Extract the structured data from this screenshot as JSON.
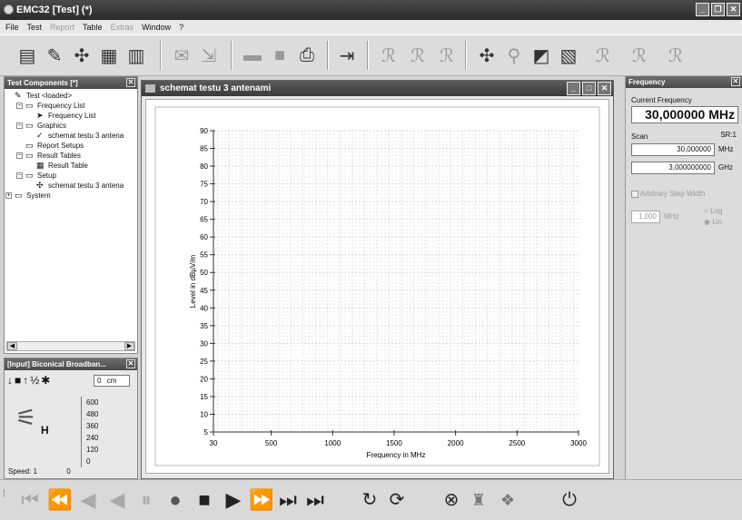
{
  "window": {
    "title": "EMC32 [Test] (*)",
    "buttons": [
      "_",
      "❐",
      "✕"
    ]
  },
  "menu": [
    {
      "label": "File",
      "enabled": true
    },
    {
      "label": "Test",
      "enabled": true
    },
    {
      "label": "Report",
      "enabled": false
    },
    {
      "label": "Table",
      "enabled": true
    },
    {
      "label": "Extras",
      "enabled": false
    },
    {
      "label": "Window",
      "enabled": true
    },
    {
      "label": "?",
      "enabled": true
    }
  ],
  "toolbar_icons": [
    "report-editor-icon",
    "graphics-edit-icon",
    "test-setup-icon",
    "device-list-icon",
    "result-table-icon",
    "print-preview-icon",
    "export-icon",
    "open-folder-icon",
    "save-icon",
    "print-icon",
    "exit-icon",
    "new-test-icon",
    "run-test-icon",
    "test-template-icon",
    "setup-active-icon",
    "transducer-icon",
    "graphics-icon",
    "report-icon",
    "emi-test-icon",
    "emi-test-1-icon",
    "emi-test-2-icon"
  ],
  "test_components": {
    "title": "Test Components [*]",
    "tree": [
      {
        "level": 0,
        "label": "Test <loaded>",
        "toggle": "",
        "icon": "test-icon"
      },
      {
        "level": 1,
        "label": "Frequency List",
        "toggle": "−",
        "icon": "folder-icon"
      },
      {
        "level": 2,
        "label": "Frequency List",
        "toggle": "",
        "icon": "frequency-list-icon"
      },
      {
        "level": 1,
        "label": "Graphics",
        "toggle": "−",
        "icon": "folder-icon"
      },
      {
        "level": 2,
        "label": "schemat testu 3 antena",
        "toggle": "",
        "icon": "graphics-icon"
      },
      {
        "level": 1,
        "label": "Report Setups",
        "toggle": "",
        "icon": "folder-icon"
      },
      {
        "level": 1,
        "label": "Result Tables",
        "toggle": "−",
        "icon": "folder-icon"
      },
      {
        "level": 2,
        "label": "Result Table",
        "toggle": "",
        "icon": "table-icon"
      },
      {
        "level": 1,
        "label": "Setup",
        "toggle": "−",
        "icon": "folder-icon"
      },
      {
        "level": 2,
        "label": "schemat testu 3 antena",
        "toggle": "",
        "icon": "setup-icon"
      },
      {
        "level": 0,
        "label": "System",
        "toggle": "+",
        "icon": "folder-icon"
      }
    ]
  },
  "input_panel": {
    "title": "[Input] Biconical Broadban...",
    "distance": "0",
    "distance_unit": "cm",
    "polarization": "H",
    "speed_label": "Speed:",
    "speed_value": "1",
    "speed_min": "0",
    "scale_ticks": [
      "600",
      "480",
      "360",
      "240",
      "120",
      "0"
    ]
  },
  "graphics_window": {
    "title": "schemat testu 3 antenami",
    "buttons": [
      "_",
      "□",
      "✕"
    ]
  },
  "chart_data": {
    "type": "line",
    "title": "",
    "xlabel": "Frequency in MHz",
    "ylabel": "Level in dBµV/m",
    "xlim": [
      30,
      3000
    ],
    "ylim": [
      5,
      90
    ],
    "x_ticks": [
      "30",
      "500",
      "1000",
      "1500",
      "2000",
      "2500",
      "3000"
    ],
    "y_ticks": [
      5,
      10,
      15,
      20,
      25,
      30,
      35,
      40,
      45,
      50,
      55,
      60,
      65,
      70,
      75,
      80,
      85,
      90
    ],
    "grid": true,
    "series": []
  },
  "frequency_panel": {
    "title": "Frequency",
    "current_label": "Current Frequency",
    "current_value": "30,000000",
    "current_unit": "MHz",
    "scan_label": "Scan",
    "sr_label": "SR:1",
    "scan_value": "30,000000",
    "scan_unit": "MHz",
    "scan_value2": "3,000000000",
    "scan_unit2": "GHz",
    "arb_step_label": "Arbitrary Step Width",
    "step_value": "1,000",
    "step_unit": "MHz",
    "log_label": "Log",
    "lin_label": "Lin"
  },
  "bottom_controls": [
    "go-to-start-icon",
    "skip-back-icon",
    "step-back-icon",
    "reverse-icon",
    "pause-icon",
    "record-icon",
    "stop-icon",
    "play-icon",
    "step-forward-icon",
    "skip-forward-icon",
    "go-to-end-icon",
    "single-run-icon",
    "continuous-run-icon",
    "abort-icon",
    "measure-icon",
    "settings-icon",
    "power-icon"
  ]
}
